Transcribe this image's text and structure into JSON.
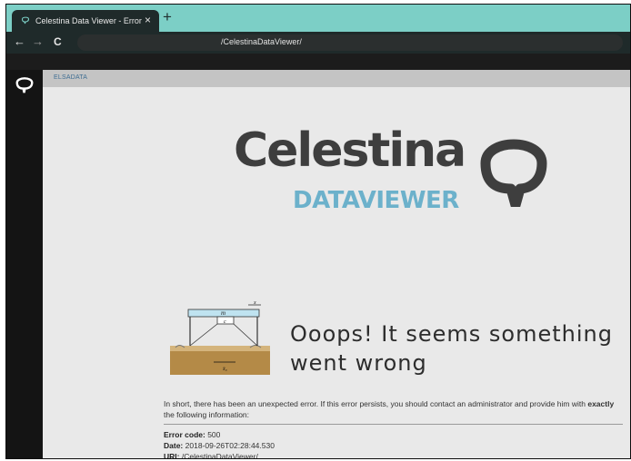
{
  "browser": {
    "tab_title": "Celestina Data Viewer - Error",
    "tab_close": "×",
    "new_tab": "+",
    "back": "←",
    "forward": "→",
    "reload": "C",
    "url": "/CelestinaDataViewer/"
  },
  "header": {
    "brand": "ELSADATA"
  },
  "logo": {
    "word": "Celestina",
    "sub": "DATAVIEWER"
  },
  "error": {
    "headline": "Ooops! It seems something went wrong",
    "intro": "In short, there has been an unexpected error. If this error persists, you should contact an administrator and provide him with",
    "intro_bold": "exactly",
    "intro_end": "the following information:",
    "code_label": "Error code:",
    "code_value": "500",
    "date_label": "Date:",
    "date_value": "2018-09-26T02:28:44.530",
    "uri_label": "URI:",
    "uri_value": "/CelestinaDataViewer/"
  },
  "illustration": {
    "mass_label": "m",
    "c_label": "c",
    "x_label": "x",
    "x0_label": "x̄₀"
  },
  "colors": {
    "tab_strip": "#7ccfc6",
    "logo_dark": "#3e3e3e",
    "logo_blue": "#6cb1cb"
  }
}
